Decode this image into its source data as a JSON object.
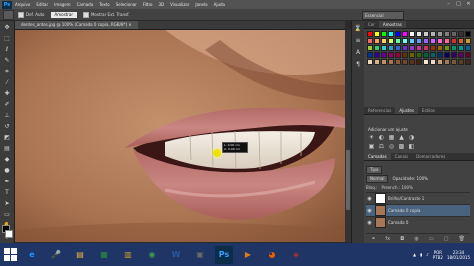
{
  "app": {
    "logo": "Ps"
  },
  "menu": [
    "Arquivo",
    "Editar",
    "Imagem",
    "Camada",
    "Texto",
    "Selecionar",
    "Filtro",
    "3D",
    "Visualizar",
    "Janela",
    "Ajuda"
  ],
  "window_controls": [
    "minimize-icon",
    "maximize-icon",
    "close-icon"
  ],
  "options_bar": {
    "sample_all_label": "Def. Auto",
    "sample_value": "Amostrar",
    "sample_all_layers_label": "Mostrar Ext. Transf.",
    "workspace": "Essencial"
  },
  "document": {
    "tab_title": "dentes_antes.jpg @ 100% (Camada 0 copia, RGB/8*)"
  },
  "tooltip": {
    "line1": "L: 0,00 cm",
    "line2": "A: 0,00 cm"
  },
  "swatch_colors": [
    "#ff0000",
    "#ffff00",
    "#00ff00",
    "#00ffff",
    "#0000ff",
    "#ff00ff",
    "#ffffff",
    "#e6e6e6",
    "#cccccc",
    "#b3b3b3",
    "#999999",
    "#808080",
    "#666666",
    "#333333",
    "#000000",
    "#ff6666",
    "#ff9966",
    "#ffcc66",
    "#ccff66",
    "#66ff99",
    "#66ffff",
    "#66ccff",
    "#6699ff",
    "#9966ff",
    "#cc66ff",
    "#ff66cc",
    "#ff6699",
    "#cc3333",
    "#cc6633",
    "#cc9933",
    "#99cc33",
    "#33cc66",
    "#33cccc",
    "#3399cc",
    "#3366cc",
    "#6633cc",
    "#9933cc",
    "#cc3399",
    "#cc3366",
    "#993300",
    "#996600",
    "#669900",
    "#009966",
    "#009999",
    "#006699",
    "#003399",
    "#330099",
    "#660099",
    "#990066",
    "#990033",
    "#663300",
    "#666600",
    "#336600",
    "#006633",
    "#006666",
    "#003366",
    "#000066",
    "#330066",
    "#660066",
    "#660033",
    "#f2d7b6",
    "#d9b38c",
    "#bf8f66",
    "#a6734d",
    "#8c5a3a",
    "#734529",
    "#5a331c",
    "#402310",
    "#f7e7ce",
    "#eed9c4",
    "#c7a17a",
    "#9e7a55",
    "#7a5a3c",
    "#5a3f28",
    "#3d2a1a"
  ],
  "panels": {
    "top_tabs": [
      "Cor",
      "Amostras"
    ],
    "mid_tabs": [
      "Referencias",
      "Ajustes",
      "Estilos"
    ],
    "adjust_title": "Adicionar um ajuste",
    "adjust_icons": [
      "☀",
      "◐",
      "▦",
      "▲",
      "◑",
      "▣",
      "⚖",
      "◎",
      "▩",
      "◧"
    ],
    "layer_tabs": [
      "Camadas",
      "Canais",
      "Demarcadores"
    ],
    "kind_label": "Tipo",
    "blend_mode": "Normal",
    "opacity_label": "Opacidade: 100%",
    "lock_label": "Bloq.:",
    "fill_label": "Preench.: 100%",
    "layers": [
      {
        "name": "Brilho/Contraste 1",
        "thumb_color": "#ffffff"
      },
      {
        "name": "Camada 0 copia",
        "thumb_color": "#a77655"
      },
      {
        "name": "Camada 0",
        "thumb_color": "#a77655"
      }
    ],
    "footer_icons": [
      "⚭",
      "fx",
      "◘",
      "◍",
      "▭",
      "▢",
      "🗑"
    ]
  },
  "taskbar": {
    "apps": [
      {
        "name": "ie-icon",
        "label": "e",
        "color": "#1e90ff"
      },
      {
        "name": "recorder-icon",
        "label": "🎤",
        "color": "#d9533d"
      },
      {
        "name": "explorer-icon",
        "label": "▤",
        "color": "#e7b53b"
      },
      {
        "name": "calculator-icon",
        "label": "▦",
        "color": "#2d8f3a"
      },
      {
        "name": "notes-icon",
        "label": "▥",
        "color": "#c9a227"
      },
      {
        "name": "chrome-icon",
        "label": "◉",
        "color": "#3c9a47"
      },
      {
        "name": "word-icon",
        "label": "W",
        "color": "#2b579a"
      },
      {
        "name": "photos-icon",
        "label": "▣",
        "color": "#6a6a6a"
      },
      {
        "name": "photoshop-icon",
        "label": "Ps",
        "color": "#0c2d4a"
      },
      {
        "name": "media-icon",
        "label": "▶",
        "color": "#d97a1c"
      },
      {
        "name": "firefox-icon",
        "label": "◕",
        "color": "#e66000"
      },
      {
        "name": "video-icon",
        "label": "◈",
        "color": "#b03030"
      }
    ],
    "language": "POR",
    "layout": "PTB2",
    "time": "23:34",
    "date": "18/01/2015"
  }
}
